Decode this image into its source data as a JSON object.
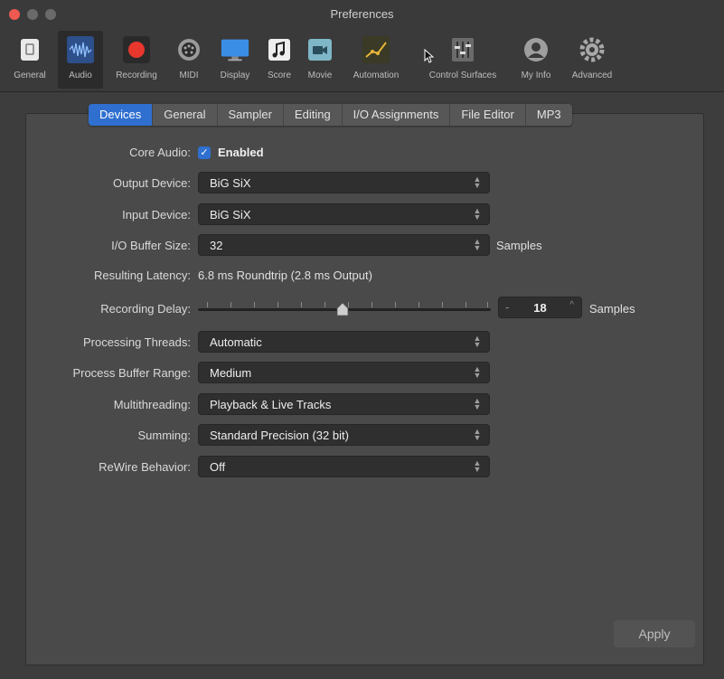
{
  "window": {
    "title": "Preferences"
  },
  "toolbar": {
    "items": [
      {
        "label": "General",
        "icon": "switch-icon"
      },
      {
        "label": "Audio",
        "icon": "waveform-icon"
      },
      {
        "label": "Recording",
        "icon": "record-icon"
      },
      {
        "label": "MIDI",
        "icon": "midi-port-icon"
      },
      {
        "label": "Display",
        "icon": "monitor-icon"
      },
      {
        "label": "Score",
        "icon": "music-note-icon"
      },
      {
        "label": "Movie",
        "icon": "video-camera-icon"
      },
      {
        "label": "Automation",
        "icon": "automation-curve-icon"
      },
      {
        "label": "Control Surfaces",
        "icon": "mixer-faders-icon"
      },
      {
        "label": "My Info",
        "icon": "person-icon"
      },
      {
        "label": "Advanced",
        "icon": "gear-icon"
      }
    ],
    "selected": "Audio"
  },
  "tabs": [
    "Devices",
    "General",
    "Sampler",
    "Editing",
    "I/O Assignments",
    "File Editor",
    "MP3"
  ],
  "active_tab": "Devices",
  "form": {
    "core_audio": {
      "label": "Core Audio:",
      "checkbox": "Enabled",
      "checked": true
    },
    "output_device": {
      "label": "Output Device:",
      "value": "BiG SiX"
    },
    "input_device": {
      "label": "Input Device:",
      "value": "BiG SiX"
    },
    "io_buffer": {
      "label": "I/O Buffer Size:",
      "value": "32",
      "suffix": "Samples"
    },
    "latency": {
      "label": "Resulting Latency:",
      "value": "6.8 ms Roundtrip (2.8 ms Output)"
    },
    "recording_delay": {
      "label": "Recording Delay:",
      "value": "18",
      "suffix": "Samples",
      "minus": "-",
      "plus": "^"
    },
    "processing_threads": {
      "label": "Processing Threads:",
      "value": "Automatic"
    },
    "process_buffer_range": {
      "label": "Process Buffer Range:",
      "value": "Medium"
    },
    "multithreading": {
      "label": "Multithreading:",
      "value": "Playback & Live Tracks"
    },
    "summing": {
      "label": "Summing:",
      "value": "Standard Precision (32 bit)"
    },
    "rewire": {
      "label": "ReWire Behavior:",
      "value": "Off"
    }
  },
  "apply_button": "Apply",
  "colors": {
    "accent": "#2f6fd0",
    "record": "#e8372c",
    "close": "#ee5a52"
  }
}
